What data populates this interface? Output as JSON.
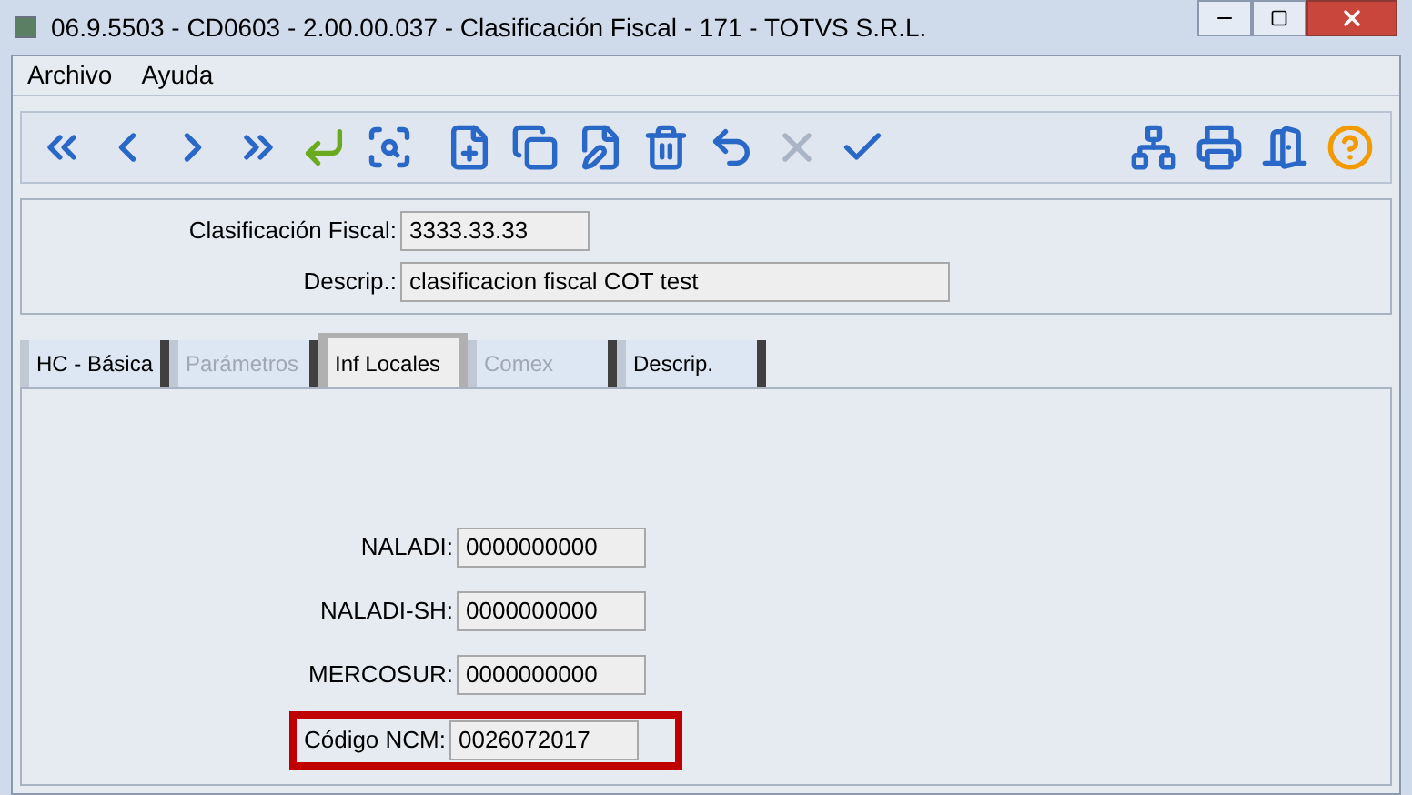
{
  "window": {
    "title": "06.9.5503 - CD0603 - 2.00.00.037 - Clasificación Fiscal - 171 - TOTVS S.R.L."
  },
  "menu": [
    "Archivo",
    "Ayuda"
  ],
  "header_fields": [
    {
      "label": "Clasificación Fiscal:",
      "value": "3333.33.33",
      "wide": false
    },
    {
      "label": "Descrip.:",
      "value": "clasificacion fiscal COT test",
      "wide": true
    }
  ],
  "tabs": [
    {
      "label": "HC - Básica",
      "selected": false,
      "disabled": false
    },
    {
      "label": "Parámetros",
      "selected": false,
      "disabled": true
    },
    {
      "label": "Inf Locales",
      "selected": true,
      "disabled": false
    },
    {
      "label": "Comex",
      "selected": false,
      "disabled": true
    },
    {
      "label": "Descrip.",
      "selected": false,
      "disabled": false
    }
  ],
  "fields": [
    {
      "label": "NALADI:",
      "value": "0000000000",
      "highlighted": false
    },
    {
      "label": "NALADI-SH:",
      "value": "0000000000",
      "highlighted": false
    },
    {
      "label": "MERCOSUR:",
      "value": "0000000000",
      "highlighted": false
    },
    {
      "label": "Código NCM:",
      "value": "0026072017",
      "highlighted": true
    }
  ]
}
